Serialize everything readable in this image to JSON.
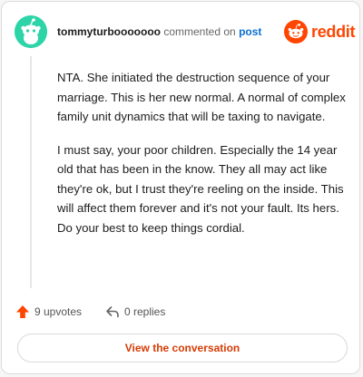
{
  "comment": {
    "username": "tommyturbooooooo",
    "action_text": "commented on",
    "post_link": "post",
    "brand_name": "reddit",
    "paragraphs": [
      "NTA. She initiated the destruction sequence of your marriage. This is her new normal. A normal of complex family unit dynamics that will be taxing to navigate.",
      "I must say, your poor children. Especially the 14 year old that has been in the know. They all may act like they're ok, but I trust they're reeling on the inside. This will affect them forever and it's not your fault. Its hers. Do your best to keep things cordial."
    ],
    "upvotes_label": "9 upvotes",
    "replies_label": "0 replies",
    "view_button_label": "View the conversation"
  },
  "colors": {
    "brand": "#ff4500",
    "link": "#0a6fd1",
    "button_text": "#d63c06",
    "avatar_bg": "#2dd4a8"
  },
  "icons": {
    "avatar": "snoo-avatar-icon",
    "logo": "reddit-snoo-icon",
    "upvote": "upvote-arrow-icon",
    "reply": "reply-arrow-icon"
  }
}
